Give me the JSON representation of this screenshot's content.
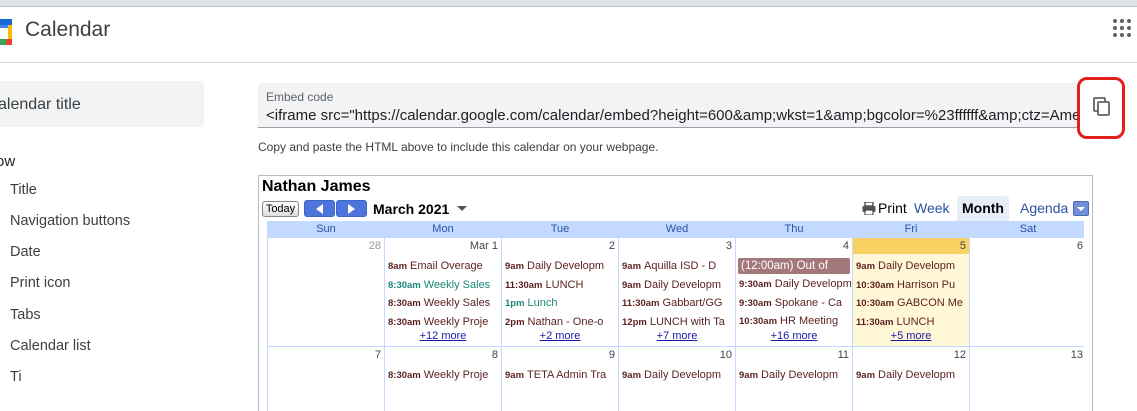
{
  "header": {
    "app_title": "Calendar",
    "apps_icon": "apps-grid-icon"
  },
  "sidebar": {
    "calendar_title_field": "alendar title",
    "section_heading": "ow",
    "items": [
      "Title",
      "Navigation buttons",
      "Date",
      "Print icon",
      "Tabs",
      "Calendar list",
      "Ti"
    ]
  },
  "embed": {
    "label": "Embed code",
    "value": "<iframe src=\"https://calendar.google.com/calendar/embed?height=600&amp;wkst=1&amp;bgcolor=%23ffffff&amp;ctz=Americ",
    "helper": "Copy and paste the HTML above to include this calendar on your webpage.",
    "copy_icon": "copy-icon",
    "highlight_color": "#e0201b"
  },
  "calendar": {
    "owner": "Nathan James",
    "today_button": "Today",
    "date_label": "March 2021",
    "print_label": "Print",
    "tabs": [
      "Week",
      "Month",
      "Agenda"
    ],
    "active_tab": "Month",
    "days_of_week": [
      "Sun",
      "Mon",
      "Tue",
      "Wed",
      "Thu",
      "Fri",
      "Sat"
    ],
    "week1": [
      {
        "num": "28",
        "dim": true,
        "events": []
      },
      {
        "num": "Mar 1",
        "events": [
          {
            "time": "8am",
            "title": "Email Overage",
            "style": "dark"
          },
          {
            "time": "8:30am",
            "title": "Weekly Sales",
            "style": "teal"
          },
          {
            "time": "8:30am",
            "title": "Weekly Sales",
            "style": "dark"
          },
          {
            "time": "8:30am",
            "title": "Weekly Proje",
            "style": "dark"
          }
        ],
        "more": "+12 more"
      },
      {
        "num": "2",
        "events": [
          {
            "time": "9am",
            "title": "Daily Developm",
            "style": "dark"
          },
          {
            "time": "11:30am",
            "title": "LUNCH",
            "style": "dark"
          },
          {
            "time": "1pm",
            "title": "Lunch",
            "style": "teal"
          },
          {
            "time": "2pm",
            "title": "Nathan - One-o",
            "style": "dark"
          }
        ],
        "more": "+2 more"
      },
      {
        "num": "3",
        "events": [
          {
            "time": "9am",
            "title": "Aquilla ISD - D",
            "style": "dark"
          },
          {
            "time": "9am",
            "title": "Daily Developm",
            "style": "dark"
          },
          {
            "time": "11:30am",
            "title": "Gabbart/GG",
            "style": "dark"
          },
          {
            "time": "12pm",
            "title": "LUNCH with Ta",
            "style": "dark"
          }
        ],
        "more": "+7 more"
      },
      {
        "num": "4",
        "allday": "(12:00am) Out of",
        "events": [
          {
            "time": "9:30am",
            "title": "Daily Developm",
            "style": "dark"
          },
          {
            "time": "9:30am",
            "title": "Spokane - Ca",
            "style": "dark"
          },
          {
            "time": "10:30am",
            "title": "HR Meeting",
            "style": "dark"
          }
        ],
        "more": "+16 more"
      },
      {
        "num": "5",
        "today": true,
        "events": [
          {
            "time": "9am",
            "title": "Daily Developm",
            "style": "dark"
          },
          {
            "time": "10:30am",
            "title": "Harrison Pu",
            "style": "dark"
          },
          {
            "time": "10:30am",
            "title": "GABCON Me",
            "style": "dark"
          },
          {
            "time": "11:30am",
            "title": "LUNCH",
            "style": "dark"
          }
        ],
        "more": "+5 more"
      },
      {
        "num": "6",
        "events": []
      }
    ],
    "week2": [
      {
        "num": "7",
        "events": []
      },
      {
        "num": "8",
        "events": [
          {
            "time": "8:30am",
            "title": "Weekly Proje",
            "style": "dark"
          }
        ]
      },
      {
        "num": "9",
        "events": [
          {
            "time": "9am",
            "title": "TETA Admin Tra",
            "style": "dark"
          }
        ]
      },
      {
        "num": "10",
        "events": [
          {
            "time": "9am",
            "title": "Daily Developm",
            "style": "dark"
          }
        ]
      },
      {
        "num": "11",
        "events": [
          {
            "time": "9am",
            "title": "Daily Developm",
            "style": "dark"
          }
        ]
      },
      {
        "num": "12",
        "events": [
          {
            "time": "9am",
            "title": "Daily Developm",
            "style": "dark"
          }
        ]
      },
      {
        "num": "13",
        "events": []
      }
    ]
  }
}
